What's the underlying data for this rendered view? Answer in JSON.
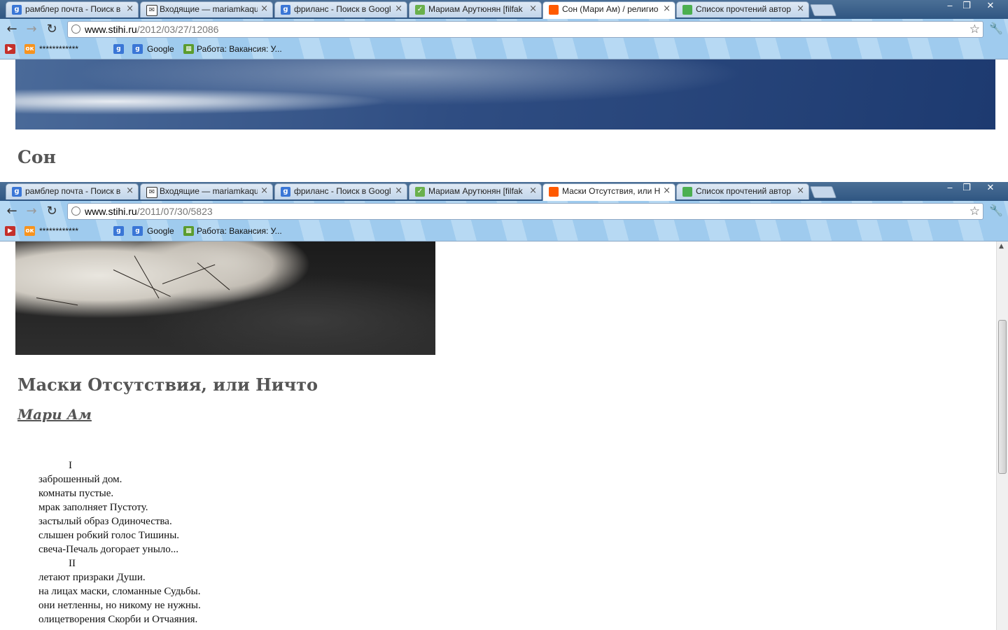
{
  "tabs": [
    {
      "title": "рамблер почта - Поиск в",
      "icon": "google-icon"
    },
    {
      "title": "Входящие — mariamkaqu",
      "icon": "mail-icon"
    },
    {
      "title": "фриланс - Поиск в Googl",
      "icon": "google-icon"
    },
    {
      "title": "Мариам Арутюнян [filfak",
      "icon": "leaf-icon"
    },
    {
      "title": "Список прочтений автор",
      "icon": "green-square-icon"
    }
  ],
  "window1": {
    "active_tab_title": "Сон (Мари Ам) / религио",
    "url_host": "www.stihi.ru",
    "url_path": "/2012/03/27/12086",
    "poem_title": "Сон"
  },
  "window2": {
    "active_tab_title": "Маски Отсутствия, или Н",
    "url_host": "www.stihi.ru",
    "url_path": "/2011/07/30/5823",
    "poem_title": "Маски Отсутствия, или Ничто",
    "author": "Мари Ам",
    "poem_lines": [
      "I",
      "заброшенный дом.",
      "комнаты пустые.",
      "мрак заполняет Пустоту.",
      "застылый образ Одиночества.",
      "слышен робкий голос Тишины.",
      "свеча-Печаль догорает уныло...",
      "II",
      "летают призраки Души.",
      "на лицах маски, сломанные Судьбы.",
      "они нетленны, но никому не нужны.",
      "олицетворения Скорби и Отчаяния."
    ]
  },
  "bookmarks": {
    "stars": "************",
    "google": "Google",
    "jobs": "Работа: Вакансия: У..."
  },
  "window_controls": {
    "minimize": "‒",
    "restore": "❐",
    "close": "✕"
  },
  "colors": {
    "accent_title": "#555555",
    "tab_active_favicon": "#ff5a00"
  }
}
